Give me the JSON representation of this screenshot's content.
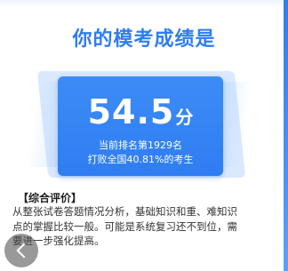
{
  "header": {
    "title": "你的模考成绩是"
  },
  "score_card": {
    "score": "54.5",
    "unit": "分",
    "rank_text": "当前排名第1929名",
    "beat_text": "打败全国40.81%的考生"
  },
  "evaluation": {
    "title": "【综合评价】",
    "lines": [
      "从整张试卷答题情况分析，基础知识和重、难知识",
      "点的掌握比较一般。可能是系统复习还不到位，需",
      "要进一步强化提高。"
    ]
  },
  "colors": {
    "accent": "#2f7df2",
    "card": "#3c8cf6"
  },
  "icons": {
    "back": "back-arrow-icon"
  }
}
